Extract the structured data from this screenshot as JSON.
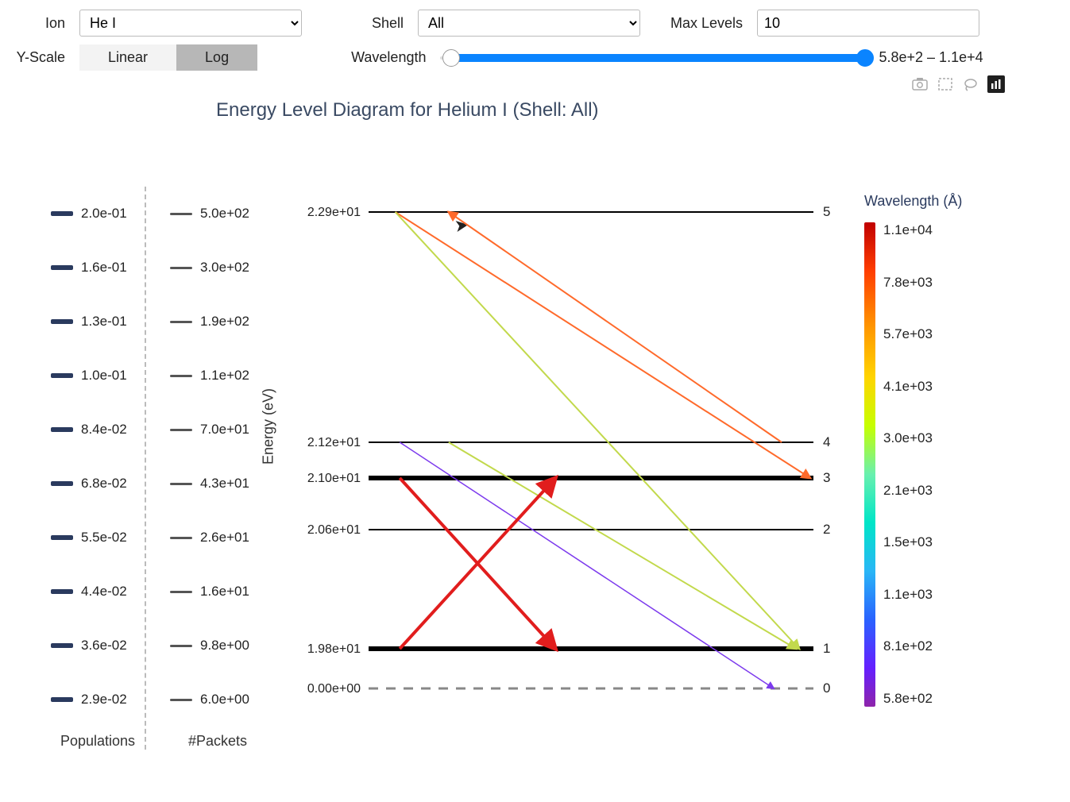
{
  "controls": {
    "ion_label": "Ion",
    "ion_value": "He I",
    "shell_label": "Shell",
    "shell_value": "All",
    "maxlv_label": "Max Levels",
    "maxlv_value": "10",
    "yscale_label": "Y-Scale",
    "yscale_linear": "Linear",
    "yscale_log": "Log",
    "yscale_active": "Log",
    "wave_label": "Wavelength",
    "wave_range_readout": "5.8e+2 – 1.1e+4"
  },
  "chart_title": "Energy Level Diagram for Helium I (Shell: All)",
  "ylabel": "Energy (eV)",
  "side_scales": {
    "populations": {
      "title": "Populations",
      "ticks": [
        "2.0e-01",
        "1.6e-01",
        "1.3e-01",
        "1.0e-01",
        "8.4e-02",
        "6.8e-02",
        "5.5e-02",
        "4.4e-02",
        "3.6e-02",
        "2.9e-02"
      ]
    },
    "packets": {
      "title": "#Packets",
      "ticks": [
        "5.0e+02",
        "3.0e+02",
        "1.9e+02",
        "1.1e+02",
        "7.0e+01",
        "4.3e+01",
        "2.6e+01",
        "1.6e+01",
        "9.8e+00",
        "6.0e+00"
      ]
    }
  },
  "colorbar": {
    "title": "Wavelength (Å)",
    "ticks": [
      "1.1e+04",
      "7.8e+03",
      "5.7e+03",
      "4.1e+03",
      "3.0e+03",
      "2.1e+03",
      "1.5e+03",
      "1.1e+03",
      "8.1e+02",
      "5.8e+02"
    ]
  },
  "chart_data": {
    "type": "diagram",
    "xlabel": "",
    "ylabel": "Energy (eV)",
    "levels": [
      {
        "index": 0,
        "energy_eV": 0.0,
        "label": "0.00e+00",
        "thick": false,
        "dashed": true
      },
      {
        "index": 1,
        "energy_eV": 19.8,
        "label": "1.98e+01",
        "thick": true,
        "dashed": false
      },
      {
        "index": 2,
        "energy_eV": 20.6,
        "label": "2.06e+01",
        "thick": false,
        "dashed": false
      },
      {
        "index": 3,
        "energy_eV": 21.0,
        "label": "2.10e+01",
        "thick": true,
        "dashed": false
      },
      {
        "index": 4,
        "energy_eV": 21.2,
        "label": "2.12e+01",
        "thick": false,
        "dashed": false
      },
      {
        "index": 5,
        "energy_eV": 22.9,
        "label": "2.29e+01",
        "thick": false,
        "dashed": false
      }
    ],
    "transitions": [
      {
        "from": 5,
        "to": 3,
        "wavelength_A": 6560,
        "color": "#ff6a2b",
        "weight": 2
      },
      {
        "from": 5,
        "to": 1,
        "wavelength_A": 4000,
        "color": "#c2d94c",
        "weight": 2
      },
      {
        "from": 5,
        "to": 4,
        "wavelength_A": 7300,
        "color": "#ff6a2b",
        "weight": 2,
        "forward": true
      },
      {
        "from": 4,
        "to": 1,
        "wavelength_A": 4470,
        "color": "#c2d94c",
        "weight": 2
      },
      {
        "from": 4,
        "to": 0,
        "wavelength_A": 590,
        "color": "#7c3aed",
        "weight": 1.5
      },
      {
        "from": 3,
        "to": 1,
        "wavelength_A": 10830,
        "color": "#e11d1d",
        "weight": 4
      },
      {
        "from": 1,
        "to": 3,
        "wavelength_A": 10830,
        "color": "#e11d1d",
        "weight": 4,
        "forward": true
      }
    ]
  }
}
